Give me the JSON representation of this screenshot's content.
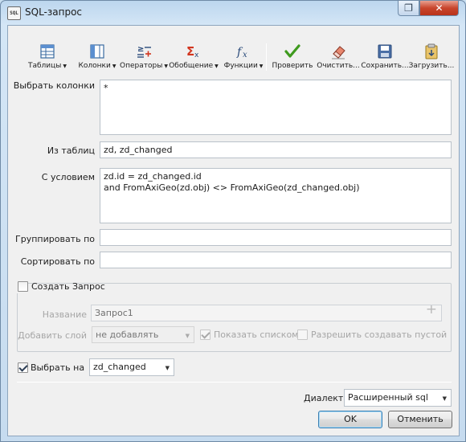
{
  "window": {
    "title": "SQL-запрос",
    "icon": "sql-app-icon",
    "restore_glyph": "❐",
    "close_glyph": "✕"
  },
  "toolbar": {
    "items": [
      {
        "label": "Таблицы",
        "icon": "table-icon",
        "dropdown": true
      },
      {
        "label": "Колонки",
        "icon": "columns-icon",
        "dropdown": true
      },
      {
        "label": "Операторы",
        "icon": "operators-icon",
        "dropdown": true
      },
      {
        "label": "Обобщение",
        "icon": "sigma-icon",
        "dropdown": true
      },
      {
        "label": "Функции",
        "icon": "function-icon",
        "dropdown": true
      },
      {
        "label": "Проверить",
        "icon": "checkmark-icon",
        "dropdown": false
      },
      {
        "label": "Очистить...",
        "icon": "eraser-icon",
        "dropdown": false
      },
      {
        "label": "Сохранить...",
        "icon": "save-icon",
        "dropdown": false
      },
      {
        "label": "Загрузить...",
        "icon": "load-icon",
        "dropdown": false
      }
    ],
    "dropdown_glyph": "▼"
  },
  "form": {
    "select_columns": {
      "label": "Выбрать колонки",
      "value": "*"
    },
    "from_tables": {
      "label": "Из таблиц",
      "value": "zd, zd_changed"
    },
    "where": {
      "label": "С условием",
      "lines": [
        "zd.id = zd_changed.id",
        "and FromAxiGeo(zd.obj) <> FromAxiGeo(zd_changed.obj)"
      ]
    },
    "group_by": {
      "label": "Группировать по",
      "value": ""
    },
    "order_by": {
      "label": "Сортировать по",
      "value": ""
    }
  },
  "create_query": {
    "label": "Создать Запрос",
    "checked": false,
    "name_label": "Название",
    "name_value": "Запрос1",
    "add_glyph": "+",
    "add_layer_label": "Добавить слой",
    "add_layer_value": "не добавлять",
    "show_as_list_label": "Показать списком",
    "show_as_list_checked": true,
    "allow_empty_label": "Разрешить создавать пустой",
    "allow_empty_checked": false
  },
  "select_into": {
    "label": "Выбрать на",
    "checked": true,
    "value": "zd_changed"
  },
  "dialect": {
    "label": "Диалект",
    "value": "Расширенный sql"
  },
  "buttons": {
    "ok": "OK",
    "cancel": "Отменить"
  },
  "colors": {
    "title_bg": "#c6dbef",
    "close_red": "#c8452c",
    "sigma_red": "#d2361f",
    "check_green": "#3e9a1e"
  }
}
